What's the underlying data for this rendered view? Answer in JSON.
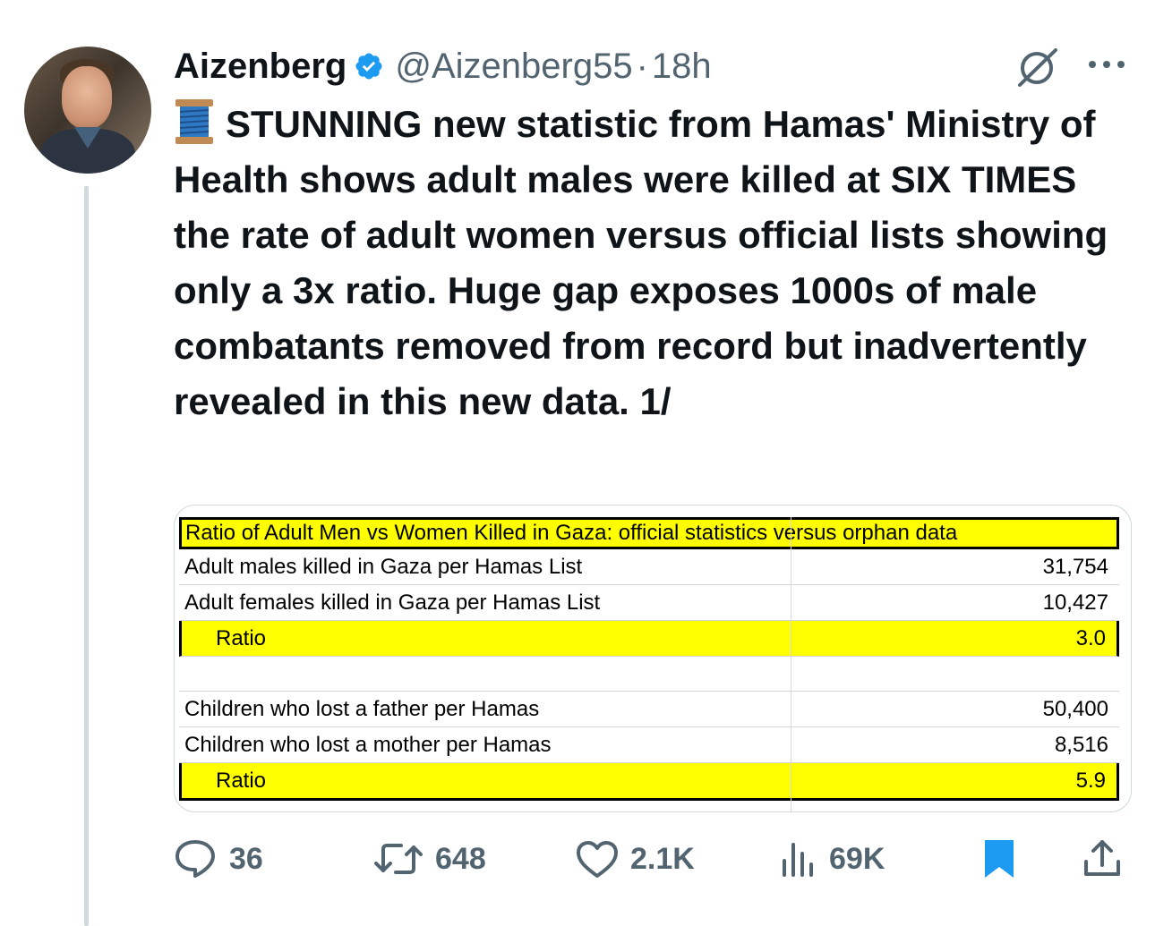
{
  "author": {
    "name": "Aizenberg",
    "handle": "@Aizenberg55",
    "separator": "·",
    "time": "18h",
    "verified_color": "#1d9bf0"
  },
  "tweet": {
    "emoji_icon": "spool-of-thread-icon",
    "text": "STUNNING new statistic from Hamas' Ministry of Health shows adult males were killed at SIX TIMES the rate of adult women versus official lists showing only a 3x ratio. Huge gap exposes 1000s of male combatants removed from record but inadvertently revealed in this new data. 1/"
  },
  "table": {
    "title": "Ratio of Adult Men vs Women Killed in Gaza: official statistics versus orphan data",
    "rows": [
      {
        "label": "Adult males killed in Gaza per Hamas List",
        "value": "31,754"
      },
      {
        "label": "Adult females killed in Gaza per Hamas List",
        "value": "10,427"
      },
      {
        "label": "Ratio",
        "value": "3.0"
      },
      {
        "label": "",
        "value": ""
      },
      {
        "label": "Children who lost a father per Hamas",
        "value": "50,400"
      },
      {
        "label": "Children who lost a mother per Hamas",
        "value": "8,516"
      },
      {
        "label": "Ratio",
        "value": "5.9"
      }
    ],
    "highlight_color": "#ffff00"
  },
  "actions": {
    "replies": "36",
    "reposts": "648",
    "likes": "2.1K",
    "views": "69K",
    "bookmark_color": "#1d9bf0"
  }
}
